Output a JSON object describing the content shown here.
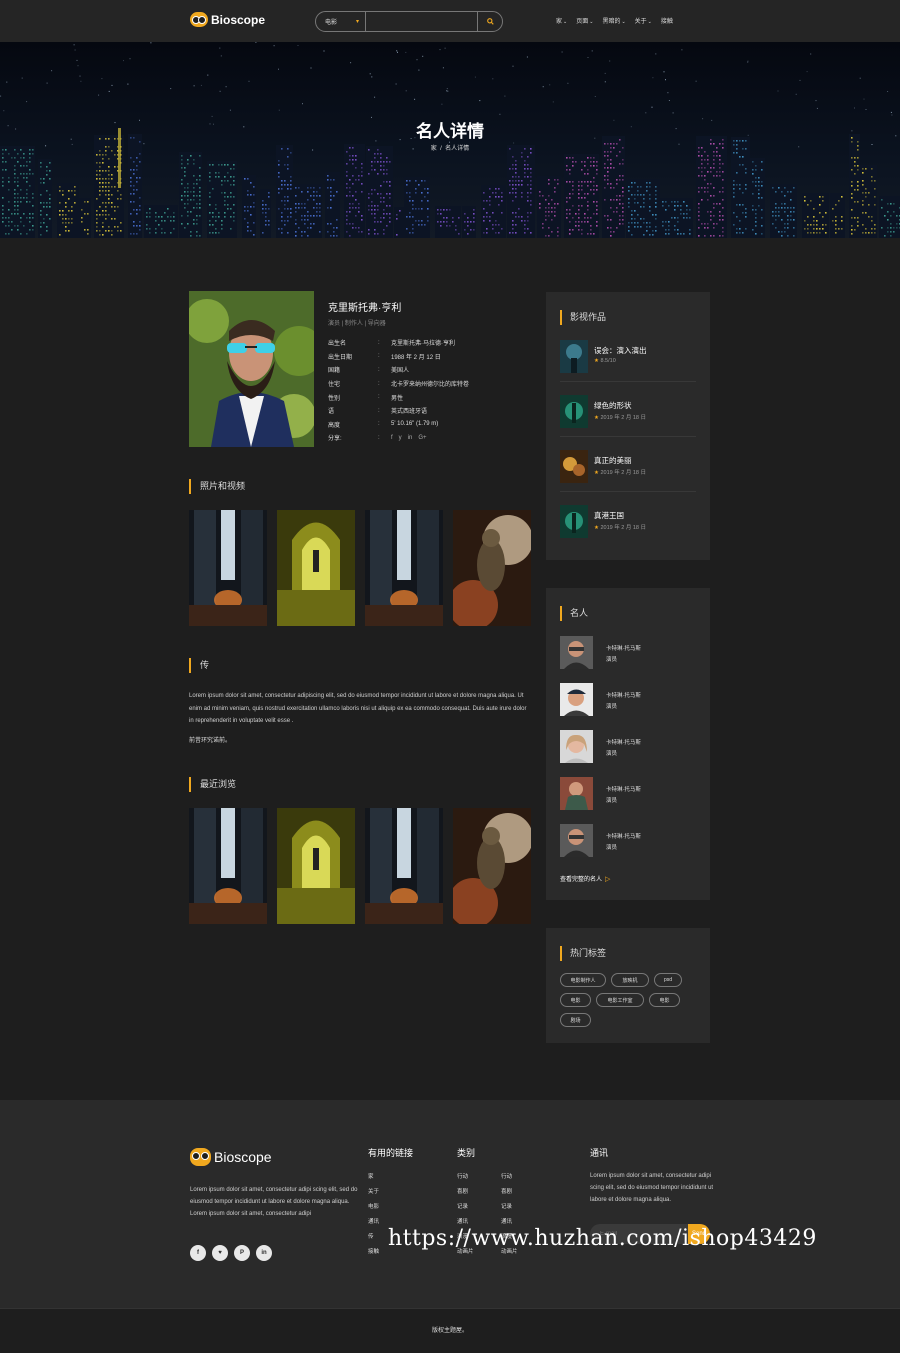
{
  "header": {
    "logo": "Bioscope",
    "search_category": "电影",
    "search_placeholder": "",
    "nav": [
      "家",
      "页面",
      "黑暗的",
      "关于",
      "接触"
    ]
  },
  "hero": {
    "title": "名人详情",
    "crumb_home": "家",
    "crumb_sep": "/",
    "crumb_current": "名人详情"
  },
  "celebrity": {
    "name": "克里斯托弗·亨利",
    "roles": "演员 | 制作人 | 导向器",
    "details": [
      {
        "key": "出生名",
        "value": "克里斯托弗·马拉德·亨利"
      },
      {
        "key": "出生日期",
        "value": "1988 年 2 月 12 日"
      },
      {
        "key": "国籍",
        "value": "美国人"
      },
      {
        "key": "住宅",
        "value": "北卡罗来纳州德尔比的库特卷"
      },
      {
        "key": "性别",
        "value": "男性"
      },
      {
        "key": "语",
        "value": "英式西班牙语"
      },
      {
        "key": "高度",
        "value": "5' 10.16\" (1.79 m)"
      }
    ],
    "share_label": "分享:",
    "share_icons": [
      "f",
      "y",
      "in",
      "G+"
    ]
  },
  "sections": {
    "photos": "照片和视频",
    "bio": "传",
    "recent": "最近浏览"
  },
  "bio": {
    "text": "Lorem ipsum dolor sit amet, consectetur adipiscing elit, sed do eiusmod tempor incididunt ut labore et dolore magna aliqua. Ut enim ad minim veniam, quis nostrud exercitation ullamco laboris nisi ut aliquip ex ea commodo consequat. Duis aute irure dolor in reprehenderit in voluptate velit esse .",
    "more": "前昔环究诺前。"
  },
  "sidebar": {
    "films_title": "影视作品",
    "films": [
      {
        "title": "误会：演入演出",
        "meta": "8.5/10"
      },
      {
        "title": "绿色的形状",
        "meta": "2019 年 2 月 18 日"
      },
      {
        "title": "真正的美丽",
        "meta": "2019 年 2 月 18 日"
      },
      {
        "title": "真港王国",
        "meta": "2019 年 2 月 18 日"
      }
    ],
    "celebs_title": "名人",
    "celebs": [
      {
        "name": "卡特琳·托马斯",
        "role": "演员"
      },
      {
        "name": "卡特琳·托马斯",
        "role": "演员"
      },
      {
        "name": "卡特琳·托马斯",
        "role": "演员"
      },
      {
        "name": "卡特琳·托马斯",
        "role": "演员"
      },
      {
        "name": "卡特琳·托马斯",
        "role": "演员"
      }
    ],
    "celebs_more": "查看完整的名人",
    "tags_title": "热门标签",
    "tags": [
      "电影制作人",
      "放映机",
      "psd",
      "电影",
      "电影工作室",
      "电影",
      "剧场"
    ]
  },
  "footer": {
    "logo": "Bioscope",
    "about": "Lorem ipsum dolor sit amet, consectetur adipi scing elit, sed do eiusmod tempor incididunt ut labore et dolore magna aliqua. Lorem ipsum dolor sit amet, consectetur adipi",
    "social": [
      "f",
      "♥",
      "P",
      "in"
    ],
    "links_title": "有用的链接",
    "links": [
      "家",
      "关于",
      "电影",
      "通讯",
      "传",
      "接触"
    ],
    "cat_title": "类别",
    "cat_col1": [
      "行动",
      "喜剧",
      "记录",
      "通讯",
      "浪漫",
      "动画片"
    ],
    "cat_col2": [
      "行动",
      "喜剧",
      "记录",
      "通讯",
      "浪漫",
      "动画片"
    ],
    "news_title": "通讯",
    "news_text": "Lorem ipsum dolor sit amet, consectetur adipi scing elit, sed do eiusmod tempor incididunt ut labore et dolore magna aliqua.",
    "sub_placeholder": "E-mail",
    "sub_button": "Send"
  },
  "copyright": "版权主题屋。",
  "watermark": "https://www.huzhan.com/ishop43429"
}
